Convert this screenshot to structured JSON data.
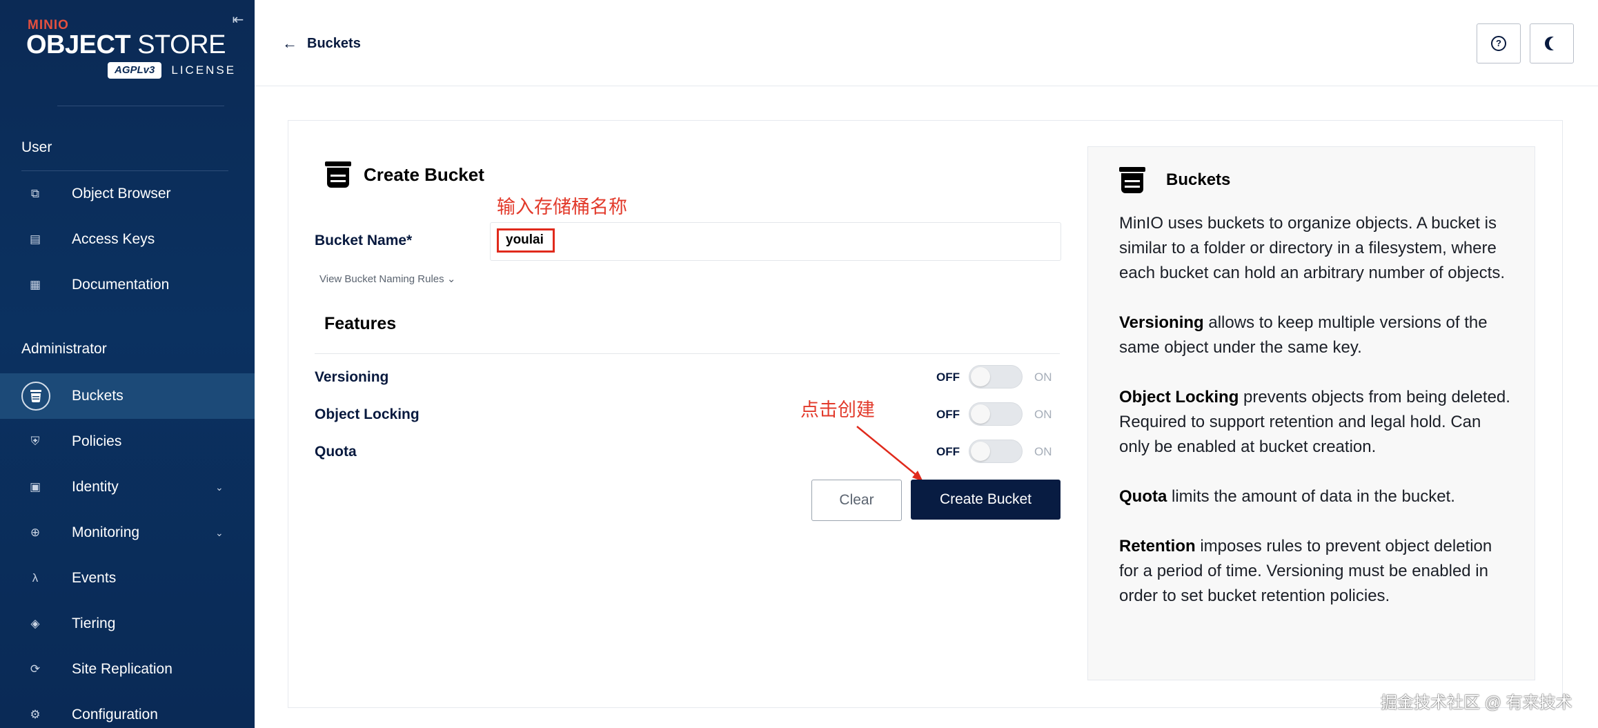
{
  "sidebar": {
    "logo": {
      "brand": "MINIO",
      "product_bold": "OBJECT",
      "product_light": "STORE",
      "agpl": "AGPLv3",
      "license": "LICENSE"
    },
    "sections": {
      "user": "User",
      "admin": "Administrator"
    },
    "user_items": [
      {
        "label": "Object Browser",
        "icon": "object-browser-icon"
      },
      {
        "label": "Access Keys",
        "icon": "access-keys-icon"
      },
      {
        "label": "Documentation",
        "icon": "documentation-icon"
      }
    ],
    "admin_items": [
      {
        "label": "Buckets",
        "icon": "bucket-icon",
        "active": true
      },
      {
        "label": "Policies",
        "icon": "shield-icon"
      },
      {
        "label": "Identity",
        "icon": "identity-icon",
        "expandable": true
      },
      {
        "label": "Monitoring",
        "icon": "monitoring-icon",
        "expandable": true
      },
      {
        "label": "Events",
        "icon": "lambda-icon"
      },
      {
        "label": "Tiering",
        "icon": "tiering-icon"
      },
      {
        "label": "Site Replication",
        "icon": "replication-icon"
      },
      {
        "label": "Configuration",
        "icon": "gear-icon"
      }
    ]
  },
  "topbar": {
    "back_label": "Buckets"
  },
  "form": {
    "title": "Create Bucket",
    "bucket_name_label": "Bucket Name*",
    "bucket_name_value": "youlai",
    "naming_rules_link": "View Bucket Naming Rules",
    "features_title": "Features",
    "features": [
      {
        "name": "Versioning",
        "off_label": "OFF",
        "on_label": "ON",
        "enabled": false
      },
      {
        "name": "Object Locking",
        "off_label": "OFF",
        "on_label": "ON",
        "enabled": false
      },
      {
        "name": "Quota",
        "off_label": "OFF",
        "on_label": "ON",
        "enabled": false
      }
    ],
    "clear_label": "Clear",
    "create_label": "Create Bucket"
  },
  "annotations": {
    "input_hint": "输入存储桶名称",
    "click_hint": "点击创建"
  },
  "help": {
    "title": "Buckets",
    "intro": "MinIO uses buckets to organize objects. A bucket is similar to a folder or directory in a filesystem, where each bucket can hold an arbitrary number of objects.",
    "items": [
      {
        "term": "Versioning",
        "text": "allows to keep multiple versions of the same object under the same key."
      },
      {
        "term": "Object Locking",
        "text": "prevents objects from being deleted. Required to support retention and legal hold. Can only be enabled at bucket creation."
      },
      {
        "term": "Quota",
        "text": "limits the amount of data in the bucket."
      },
      {
        "term": "Retention",
        "text": "imposes rules to prevent object deletion for a period of time. Versioning must be enabled in order to set bucket retention policies."
      }
    ]
  },
  "watermark": "掘金技术社区 @ 有来技术",
  "colors": {
    "sidebar_bg": "#0b2a55",
    "primary": "#081c42",
    "annotation": "#e23a2b"
  }
}
